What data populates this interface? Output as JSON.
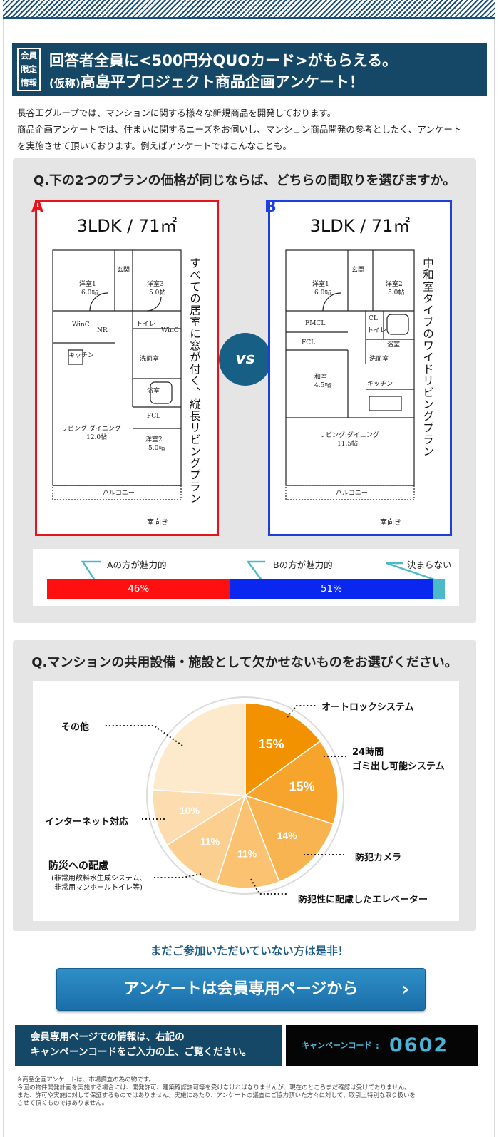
{
  "banner": {
    "badge": [
      "会員",
      "限定",
      "情報"
    ],
    "line1": "回答者全員に<500円分QUOカード>がもらえる。",
    "line2_prefix": "(仮称)",
    "line2_main": "高島平プロジェクト商品企画アンケート！"
  },
  "intro": [
    "長谷工グループでは、マンションに関する様々な新規商品を開発しております。",
    "商品企画アンケートでは、住まいに関するニーズをお伺いし、マンション商品開発の参考としたく、アンケート",
    "を実施させて頂いております。例えばアンケートではこんなことも。"
  ],
  "q1": {
    "title": "Q.下の2つのプランの価格が同じならば、どちらの間取りを選びますか。",
    "vs": "vs",
    "planA": {
      "letter": "A",
      "type": "3LDK / 71㎡",
      "caption": "すべての居室に窓が付く、縦長リビングプラン",
      "rooms": [
        "洋室1",
        "6.0帖",
        "玄関",
        "洋室3",
        "5.0帖",
        "WinC",
        "NR",
        "トイレ",
        "WinC",
        "キッチン",
        "洗面室",
        "浴室",
        "FCL",
        "リビング.ダイニング",
        "12.0帖",
        "洋室2",
        "5.0帖",
        "バルコニー"
      ],
      "south": "南向き",
      "color": "#e8121a"
    },
    "planB": {
      "letter": "B",
      "type": "3LDK / 71㎡",
      "caption": "中和室タイプのワイドリビングプラン",
      "rooms": [
        "洋室1",
        "6.0帖",
        "玄関",
        "洋室2",
        "5.0帖",
        "FMCL",
        "CL",
        "浴室",
        "トイレ",
        "FCL",
        "和室",
        "4.5帖",
        "洗面室",
        "キッチン",
        "リビング.ダイニング",
        "11.5帖",
        "バルコニー"
      ],
      "south": "南向き",
      "color": "#1d3fe0"
    },
    "results": {
      "label_a": "Aの方が魅力的",
      "label_b": "Bの方が魅力的",
      "label_c": "決まらない",
      "value_a": "46%",
      "value_b": "51%",
      "color_a": "#ff1010",
      "color_b": "#0a27f0",
      "color_c": "#4ab9c9"
    }
  },
  "q2": {
    "title": "Q.マンションの共用設備・施設として欠かせないものをお選びください。",
    "labels": {
      "autolock": "オートロックシステム",
      "garbage1": "24時間",
      "garbage2": "ゴミ出し可能システム",
      "camera": "防犯カメラ",
      "elevator": "防犯性に配慮したエレベーター",
      "disaster": "防災への配慮",
      "disaster_sub1": "(非常用飲料水生成システム、",
      "disaster_sub2": "非常用マンホールトイレ等)",
      "internet": "インターネット対応",
      "other": "その他"
    },
    "chart_data": {
      "type": "pie",
      "labels": [
        "オートロックシステム",
        "24時間ゴミ出し可能システム",
        "防犯カメラ",
        "防犯性に配慮したエレベーター",
        "防災への配慮",
        "インターネット対応",
        "その他"
      ],
      "values": [
        15,
        15,
        14,
        11,
        11,
        10,
        24
      ],
      "value_labels": [
        "15%",
        "15%",
        "14%",
        "11%",
        "11%",
        "10%",
        ""
      ],
      "colors": [
        "#f39200",
        "#f7a42c",
        "#f8b451",
        "#fac271",
        "#fbcf8f",
        "#fdddb0",
        "#fde9cc"
      ]
    }
  },
  "cta": {
    "lead": "まだご参加いただいていない方は是非！",
    "button": "アンケートは会員専用ページから",
    "chevron": "›"
  },
  "campaign": {
    "info_line1": "会員専用ページでの情報は、右記の",
    "info_line2": "キャンペーンコードをご入力の上、ご覧ください。",
    "code_label": "キャンペーンコード",
    "colon": ":",
    "code": "0602"
  },
  "footnote": [
    "※商品企画アンケートは、市場調査の為の物です。",
    "今回の物件開発計画を実施する場合には、開発許可、建築確認許可等を受けなければなりませんが、現在のところまだ確認は受けておりません。",
    "また、許可や実施に対して保証するものではありません。実施にあたり、アンケートの議査にご協力頂いた方々に対して、取引上特別な取り扱いを",
    "させて頂くものではありません。"
  ]
}
